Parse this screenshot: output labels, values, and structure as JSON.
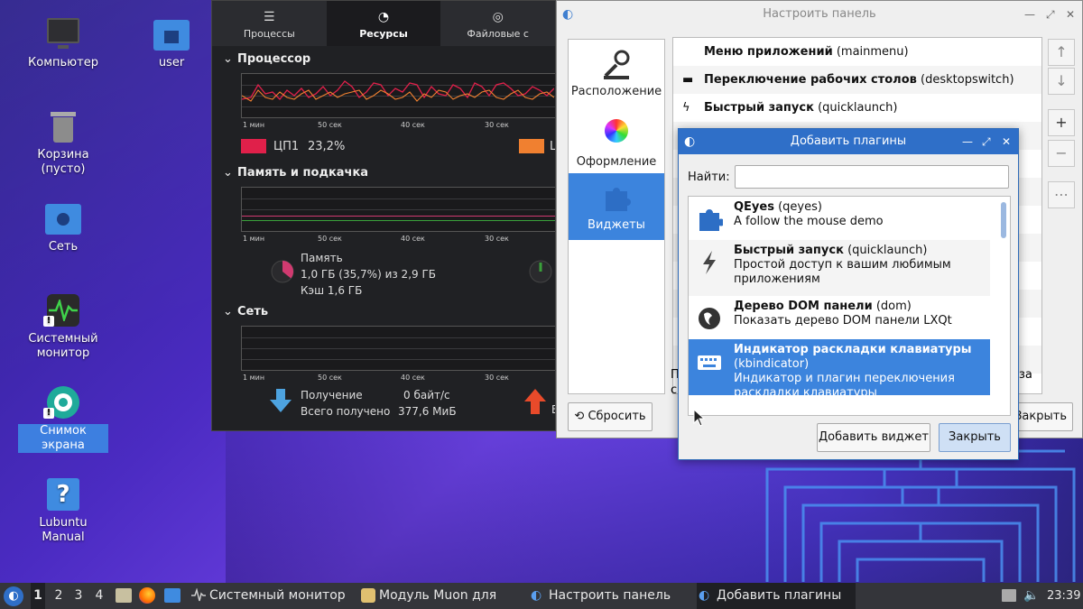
{
  "desktop": {
    "icons": [
      {
        "label": "Компьютер"
      },
      {
        "label": "user"
      },
      {
        "label": "Корзина (пусто)"
      },
      {
        "label": "Сеть"
      },
      {
        "label": "Системный монитор"
      },
      {
        "label": "Снимок экрана"
      },
      {
        "label": "Lubuntu Manual"
      }
    ]
  },
  "sysmon": {
    "tabs": [
      "Процессы",
      "Ресурсы",
      "Файловые с"
    ],
    "sections": {
      "cpu": "Процессор",
      "memory": "Память и подкачка",
      "network": "Сеть"
    },
    "ticks": [
      "1 мин",
      "50 сек",
      "40 сек",
      "30 сек"
    ],
    "cpu_legend": {
      "name": "ЦП1",
      "value": "23,2%",
      "second_label": "L"
    },
    "memory": {
      "label": "Память",
      "used": "1,0 ГБ (35,7%) из 2,9 ГБ",
      "cache": "Кэш 1,6 ГБ",
      "fraction": 0.357
    },
    "network": {
      "recv_label": "Получение",
      "recv_value": "0 байт/с",
      "total_label": "Всего получено",
      "total_value": "377,6 МиБ",
      "send_short": "E"
    },
    "colors": {
      "cpu1": "#e0204a",
      "cpu2": "#f08030"
    }
  },
  "cpanel": {
    "title": "Настроить панель",
    "sidebar": [
      "Расположение",
      "Оформление",
      "Виджеты"
    ],
    "plugins": [
      {
        "name": "Меню приложений",
        "id": "(mainmenu)"
      },
      {
        "name": "Переключение рабочих столов",
        "id": "(desktopswitch)"
      },
      {
        "name": "Быстрый запуск",
        "id": "(quicklaunch)"
      }
    ],
    "partial_left": "П",
    "partial_left2": "с",
    "partial_right": "за",
    "reset_label": "Сбросить",
    "close_partial": "Закрыть"
  },
  "addplugins": {
    "title": "Добавить плагины",
    "find_label": "Найти:",
    "find_value": "",
    "items": [
      {
        "name": "QEyes",
        "id": "(qeyes)",
        "desc": "A follow the mouse demo"
      },
      {
        "name": "Быстрый запуск",
        "id": "(quicklaunch)",
        "desc": "Простой доступ к вашим любимым",
        "desc2": "приложениям"
      },
      {
        "name": "Дерево DOM панели",
        "id": "(dom)",
        "desc": "Показать дерево DOM панели LXQt"
      },
      {
        "name": "Индикатор раскладки клавиатуры",
        "id": "(kbindicator)",
        "desc": "Индикатор и плагин переключения",
        "desc2": "раскладки клавиатуры"
      }
    ],
    "add_label": "Добавить виджет",
    "close_label": "Закрыть"
  },
  "taskbar": {
    "desktops": [
      "1",
      "2",
      "3",
      "4"
    ],
    "windows": [
      {
        "label": "Системный монитор"
      },
      {
        "label": "Модуль Muon для уп..."
      },
      {
        "label": "Настроить панель"
      },
      {
        "label": "Добавить плагины"
      }
    ],
    "time": "23:39"
  }
}
